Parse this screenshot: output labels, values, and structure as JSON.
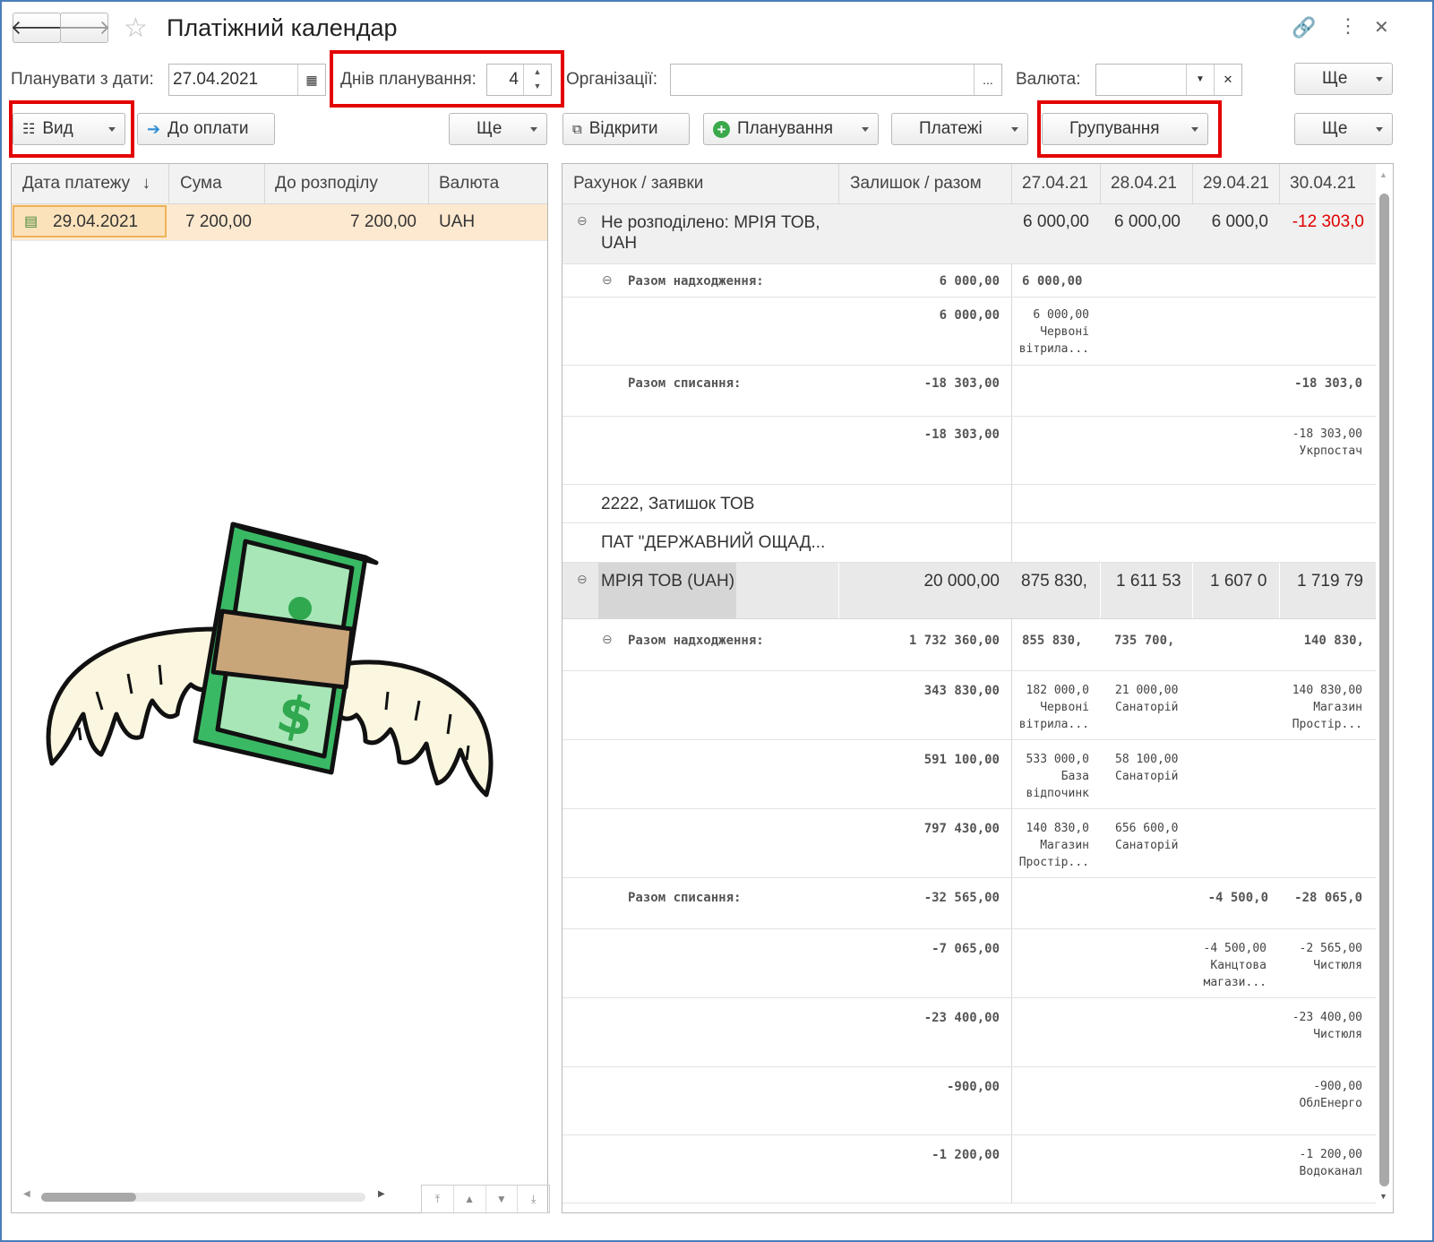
{
  "title": "Платіжний календар",
  "filter": {
    "plan_from_label": "Планувати з дати:",
    "plan_from_value": "27.04.2021",
    "days_label": "Днів планування:",
    "days_value": "4",
    "org_label": "Організації:",
    "org_value": "",
    "org_button": "...",
    "currency_label": "Валюта:",
    "currency_value": "",
    "more": "Ще"
  },
  "left_toolbar": {
    "view": "Вид",
    "to_pay": "До оплати",
    "more": "Ще"
  },
  "right_toolbar": {
    "open": "Відкрити",
    "planning": "Планування",
    "payments": "Платежі",
    "grouping": "Групування",
    "more": "Ще"
  },
  "left_table": {
    "columns": [
      "Дата платежу",
      "Сума",
      "До розподілу",
      "Валюта"
    ],
    "sort_indicator": "↓",
    "rows": [
      {
        "date": "29.04.2021",
        "sum": "7 200,00",
        "distribute": "7 200,00",
        "currency": "UAH"
      }
    ]
  },
  "right_table": {
    "columns": [
      "Рахунок / заявки",
      "Залишок / разом",
      "27.04.21",
      "28.04.21",
      "29.04.21",
      "30.04.21"
    ],
    "rows": [
      {
        "name": "Не розподілено: МРІЯ ТОВ, UAH",
        "total": "",
        "d1": "6 000,00",
        "d2": "6 000,00",
        "d3": "6 000,0",
        "d4": "-12 303,0"
      },
      {
        "name": "Разом надходження:",
        "total": "6 000,00",
        "d1": "6 000,00",
        "d2": "",
        "d3": "",
        "d4": ""
      },
      {
        "name": "",
        "total": "6 000,00",
        "d1": "6 000,00\nЧервоні\nвітрила...",
        "d2": "",
        "d3": "",
        "d4": ""
      },
      {
        "name": "Разом списання:",
        "total": "-18 303,00",
        "d1": "",
        "d2": "",
        "d3": "",
        "d4": "-18 303,0"
      },
      {
        "name": "",
        "total": "-18 303,00",
        "d1": "",
        "d2": "",
        "d3": "",
        "d4": "-18 303,00\nУкрпостач"
      },
      {
        "name": "2222, Затишок ТОВ",
        "total": "",
        "d1": "",
        "d2": "",
        "d3": "",
        "d4": ""
      },
      {
        "name": "ПАТ \"ДЕРЖАВНИЙ ОЩАД...",
        "total": "",
        "d1": "",
        "d2": "",
        "d3": "",
        "d4": ""
      },
      {
        "name": "МРІЯ ТОВ (UAH)",
        "total": "20 000,00",
        "d1": "875 830,",
        "d2": "1 611 53",
        "d3": "1 607 0",
        "d4": "1 719 79"
      },
      {
        "name": "Разом надходження:",
        "total": "1 732 360,00",
        "d1": "855 830,",
        "d2": "735 700,",
        "d3": "",
        "d4": "140 830,"
      },
      {
        "name": "",
        "total": "343 830,00",
        "d1": "182 000,0\nЧервоні\nвітрила...",
        "d2": "21 000,00\nСанаторій",
        "d3": "",
        "d4": "140 830,00\nМагазин\nПростір..."
      },
      {
        "name": "",
        "total": "591 100,00",
        "d1": "533 000,0\nБаза\nвідпочинк",
        "d2": "58 100,00\nСанаторій",
        "d3": "",
        "d4": ""
      },
      {
        "name": "",
        "total": "797 430,00",
        "d1": "140 830,0\nМагазин\nПростір...",
        "d2": "656 600,0\nСанаторій",
        "d3": "",
        "d4": ""
      },
      {
        "name": "Разом списання:",
        "total": "-32 565,00",
        "d1": "",
        "d2": "",
        "d3": "-4 500,0",
        "d4": "-28 065,0"
      },
      {
        "name": "",
        "total": "-7 065,00",
        "d1": "",
        "d2": "",
        "d3": "-4 500,00\nКанцтова\nмагази...",
        "d4": "-2 565,00\nЧистюля"
      },
      {
        "name": "",
        "total": "-23 400,00",
        "d1": "",
        "d2": "",
        "d3": "",
        "d4": "-23 400,00\nЧистюля"
      },
      {
        "name": "",
        "total": "-900,00",
        "d1": "",
        "d2": "",
        "d3": "",
        "d4": "-900,00\nОблЕнерго"
      },
      {
        "name": "",
        "total": "-1 200,00",
        "d1": "",
        "d2": "",
        "d3": "",
        "d4": "-1 200,00\nВодоканал"
      }
    ]
  },
  "colors": {
    "negative": "#e00000",
    "highlight_border": "#e30000",
    "selected_row": "#fde9cf"
  },
  "icons": [
    "back-arrow-icon",
    "forward-arrow-icon",
    "star-icon",
    "link-icon",
    "kebab-icon",
    "close-icon",
    "calendar-icon",
    "money-with-wings-icon"
  ]
}
